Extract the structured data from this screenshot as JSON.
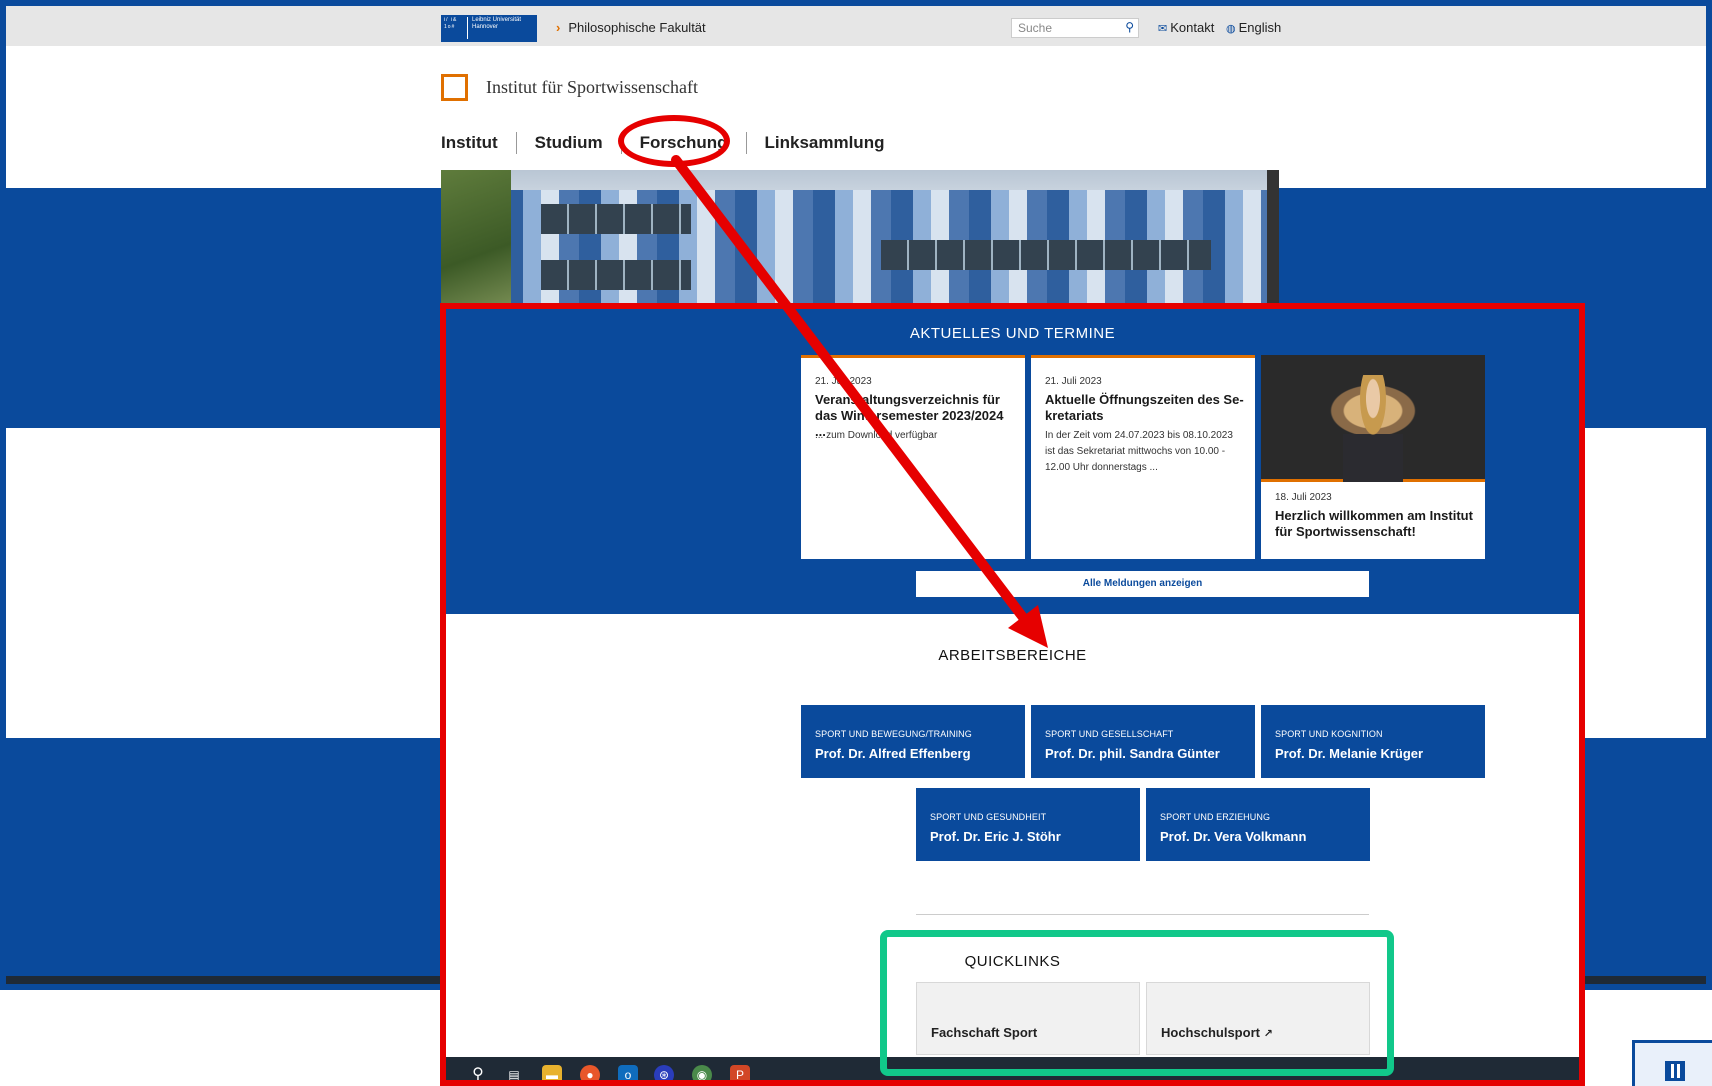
{
  "topbar": {
    "breadcrumb": "Philosophische Fakultät",
    "search_placeholder": "Suche",
    "contact": "Kontakt",
    "language": "English",
    "logo_text": "Leibniz Universität Hannover"
  },
  "institute": {
    "title": "Institut für Sportwissenschaft"
  },
  "nav": {
    "items": [
      "Institut",
      "Studium",
      "Forschung",
      "Linksammlung"
    ]
  },
  "news": {
    "section_title": "AKTUELLES UND TERMINE",
    "cards": [
      {
        "date": "21. Juli 2023",
        "headline": "Veranstaltungsverzeichnis für das Wintersemester 2023/2024 ...",
        "text": "... zum Download verfügbar"
      },
      {
        "date": "21. Juli 2023",
        "headline": "Aktuelle Öffnungszeiten des Se-kretariats",
        "text": "In der Zeit vom 24.07.2023 bis 08.10.2023 ist das Sekretariat mittwochs von 10.00 - 12.00 Uhr donnerstags ..."
      },
      {
        "date": "18. Juli 2023",
        "headline": "Herzlich willkommen am Institut für Sportwissenschaft!",
        "text": ""
      }
    ],
    "all_button": "Alle Meldungen anzeigen"
  },
  "areas": {
    "section_title": "ARBEITSBEREICHE",
    "tiles": [
      {
        "category": "Sport und Bewegung/Training",
        "professor": "Prof. Dr. Alfred Effenberg"
      },
      {
        "category": "Sport und Gesellschaft",
        "professor": "Prof. Dr. phil. Sandra Günter"
      },
      {
        "category": "Sport und Kognition",
        "professor": "Prof. Dr. Melanie Krüger"
      },
      {
        "category": "Sport und Gesundheit",
        "professor": "Prof. Dr. Eric J. Stöhr"
      },
      {
        "category": "Sport und Erziehung",
        "professor": "Prof. Dr. Vera Volkmann"
      }
    ]
  },
  "quicklinks": {
    "section_title": "QUICKLINKS",
    "items": [
      "Fachschaft Sport",
      "Hochschulsport"
    ]
  },
  "colors": {
    "brand_blue": "#0a4a9c",
    "accent_orange": "#e07000",
    "annotation_red": "#e60000",
    "annotation_green": "#11c88a"
  },
  "icons": [
    "search-icon",
    "mail-icon",
    "globe-icon",
    "chevron-right-icon",
    "external-link-icon",
    "arrow-annotation"
  ]
}
